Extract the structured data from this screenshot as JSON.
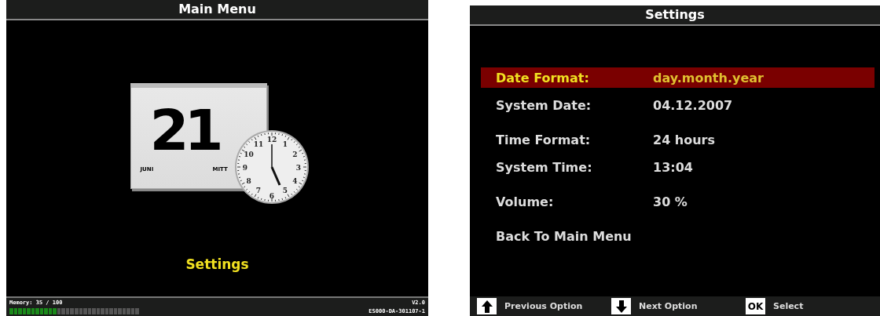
{
  "main_menu": {
    "title": "Main Menu",
    "calendar": {
      "day": "21",
      "month": "JUNI",
      "weekday": "MITT"
    },
    "clock": {
      "numeral_rows": [
        [
          "12"
        ],
        [
          "11",
          "1"
        ],
        [
          "10",
          "2"
        ],
        [
          "9",
          "3"
        ],
        [
          "8",
          "4"
        ],
        [
          "7",
          "5"
        ],
        [
          "6"
        ]
      ]
    },
    "caption": "Settings",
    "memory": {
      "label": "Memory: 35 / 100",
      "level": 0.35
    },
    "version": "V2.0",
    "build": "ES000-DA-301107-1"
  },
  "settings": {
    "title": "Settings",
    "groups": [
      [
        {
          "label": "Date Format:",
          "value": "day.month.year",
          "selected": true
        },
        {
          "label": "System Date:",
          "value": "04.12.2007",
          "selected": false
        }
      ],
      [
        {
          "label": "Time Format:",
          "value": "24 hours",
          "selected": false
        },
        {
          "label": "System Time:",
          "value": "13:04",
          "selected": false
        }
      ],
      [
        {
          "label": "Volume:",
          "value": "30 %",
          "selected": false
        }
      ],
      [
        {
          "label": "Back To Main Menu",
          "selected": false
        }
      ]
    ],
    "hints": [
      {
        "kind": "up",
        "label": "Previous Option"
      },
      {
        "kind": "down",
        "label": "Next Option"
      },
      {
        "kind": "ok",
        "key": "OK",
        "label": "Select"
      }
    ]
  }
}
